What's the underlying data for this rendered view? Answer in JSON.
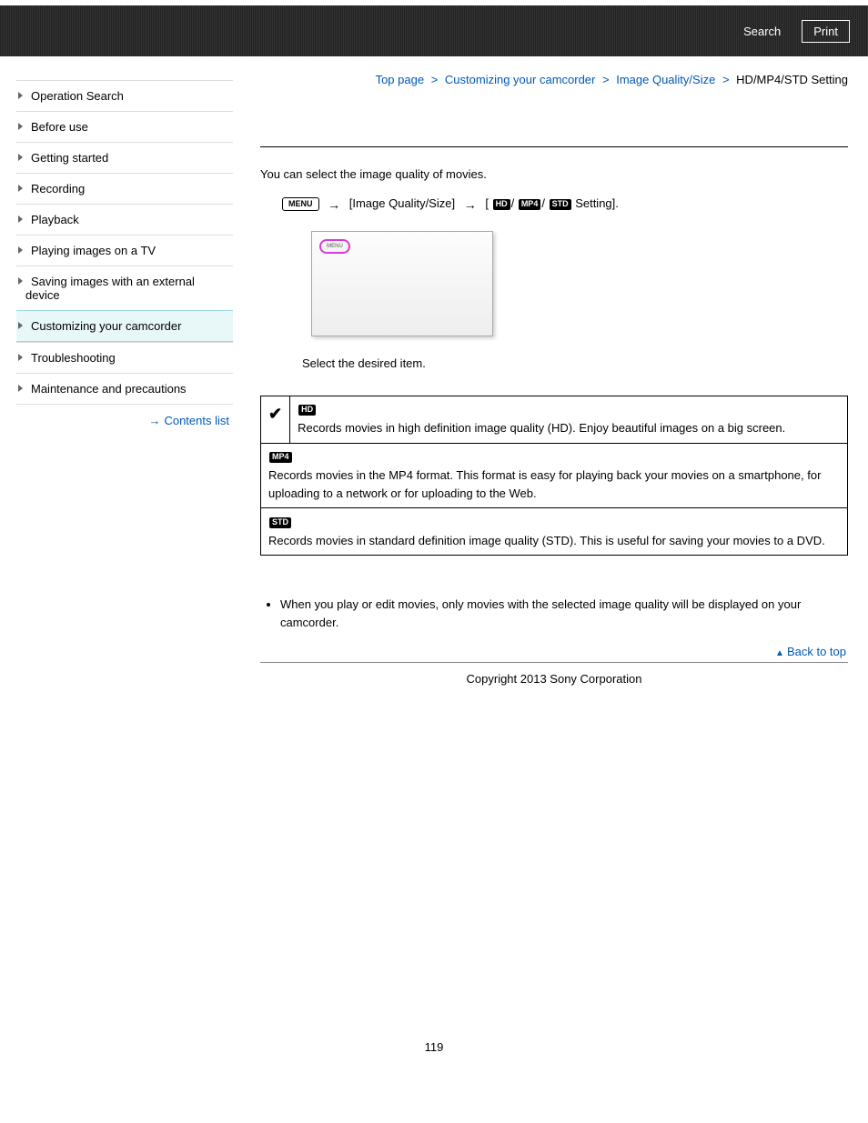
{
  "topbar": {
    "search": "Search",
    "print": "Print"
  },
  "sidebar": {
    "items": [
      {
        "label": "Operation Search"
      },
      {
        "label": "Before use"
      },
      {
        "label": "Getting started"
      },
      {
        "label": "Recording"
      },
      {
        "label": "Playback"
      },
      {
        "label": "Playing images on a TV"
      },
      {
        "label": "Saving images with an external device"
      },
      {
        "label": "Customizing your camcorder"
      },
      {
        "label": "Troubleshooting"
      },
      {
        "label": "Maintenance and precautions"
      }
    ],
    "contents_list": "Contents list"
  },
  "breadcrumb": {
    "top": "Top page",
    "l1": "Customizing your camcorder",
    "l2": "Image Quality/Size",
    "current": "HD/MP4/STD Setting"
  },
  "intro": "You can select the image quality of movies.",
  "step1": {
    "menu_label": "MENU",
    "text_a": "[Image Quality/Size]",
    "text_b": "[",
    "b1": "HD",
    "b2": "MP4",
    "b3": "STD",
    "text_c": "Setting].",
    "frame_label": "MENU"
  },
  "step2": "Select the desired item.",
  "options": {
    "hd_badge": "HD",
    "hd_text": "Records movies in high definition image quality (HD). Enjoy beautiful images on a big screen.",
    "mp4_badge": "MP4",
    "mp4_text": "Records movies in the MP4 format. This format is easy for playing back your movies on a smartphone, for uploading to a network or for uploading to the Web.",
    "std_badge": "STD",
    "std_text": "Records movies in standard definition image quality (STD). This is useful for saving your movies to a DVD."
  },
  "notes": {
    "n1": "When you play or edit movies, only movies with the selected image quality will be displayed on your camcorder."
  },
  "back_to_top": "Back to top",
  "copyright": "Copyright 2013 Sony Corporation",
  "page_number": "119"
}
